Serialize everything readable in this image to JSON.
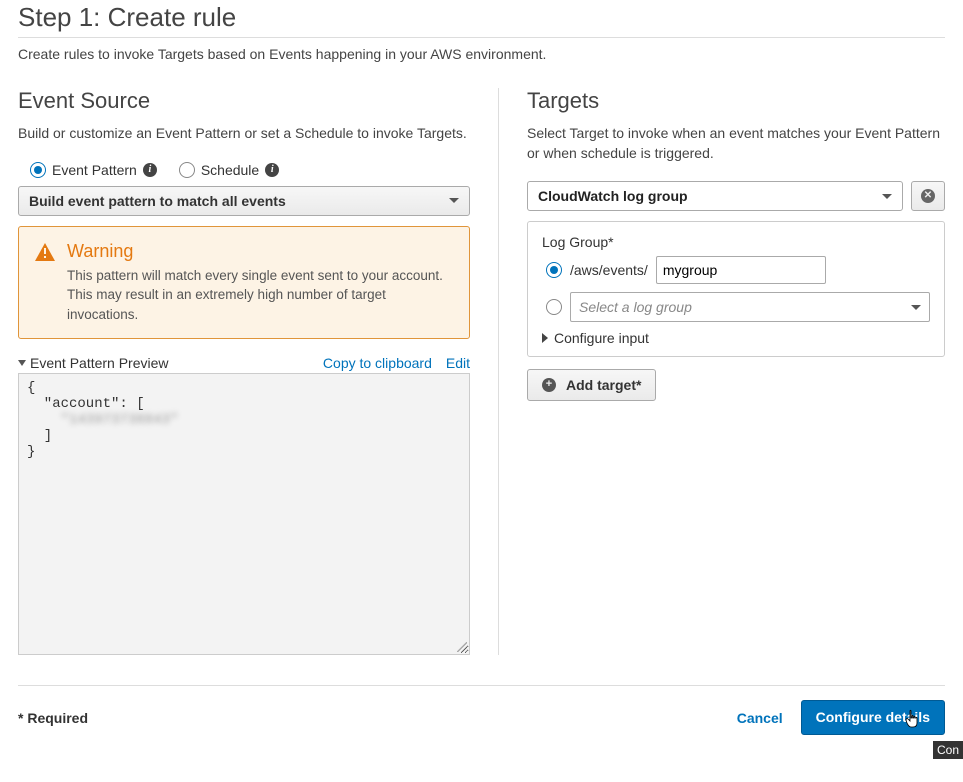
{
  "step": {
    "title": "Step 1: Create rule",
    "description": "Create rules to invoke Targets based on Events happening in your AWS environment."
  },
  "eventSource": {
    "title": "Event Source",
    "description": "Build or customize an Event Pattern or set a Schedule to invoke Targets.",
    "radios": {
      "pattern": "Event Pattern",
      "schedule": "Schedule"
    },
    "dropdown": "Build event pattern to match all events",
    "warning": {
      "title": "Warning",
      "body": "This pattern will match every single event sent to your account. This may result in an extremely high number of target invocations."
    },
    "preview": {
      "label": "Event Pattern Preview",
      "copy": "Copy to clipboard",
      "edit": "Edit",
      "lines": {
        "l0": "{",
        "l1": "  \"account\": [",
        "l2": "    \"143973738843\"",
        "l3": "  ]",
        "l4": "}"
      }
    }
  },
  "targets": {
    "title": "Targets",
    "description": "Select Target to invoke when an event matches your Event Pattern or when schedule is triggered.",
    "selected": "CloudWatch log group",
    "logGroup": {
      "label": "Log Group*",
      "prefix": "/aws/events/",
      "value": "mygroup",
      "selectPlaceholder": "Select a log group"
    },
    "configureInput": "Configure input",
    "addTarget": "Add target*"
  },
  "footer": {
    "required": "* Required",
    "cancel": "Cancel",
    "configure": "Configure details",
    "tooltipStub": "Con"
  }
}
